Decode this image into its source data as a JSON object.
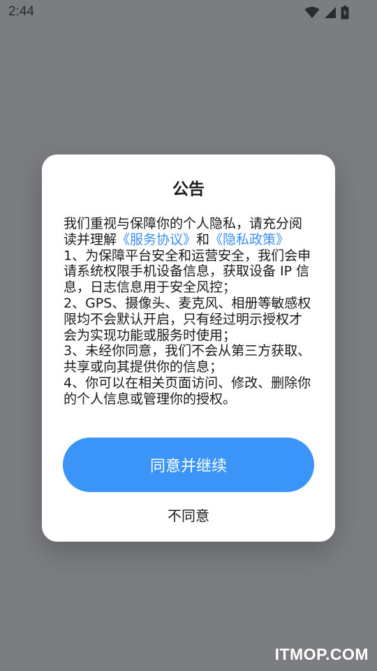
{
  "status_bar": {
    "time": "2:44",
    "icons": [
      "wifi-icon",
      "signal-icon",
      "battery-icon"
    ]
  },
  "dialog": {
    "title": "公告",
    "intro_prefix": "我们重视与保障你的个人隐私，请充分阅读并理解",
    "service_link": "《服务协议》",
    "intro_and": "和",
    "privacy_link": "《隐私政策》",
    "items": [
      "1、为保障平台安全和运营安全，我们会申请系统权限手机设备信息，获取设备 IP 信息，日志信息用于安全风控；",
      "2、GPS、摄像头、麦克风、相册等敏感权限均不会默认开启，只有经过明示授权才会为实现功能或服务时使用；",
      "3、未经你同意，我们不会从第三方获取、共享或向其提供你的信息；",
      "4、你可以在相关页面访问、修改、删除你的个人信息或管理你的授权。"
    ],
    "agree_label": "同意并继续",
    "disagree_label": "不同意"
  },
  "watermark": "ITMOP.COM",
  "colors": {
    "overlay": "#7b7d80",
    "accent": "#3b94f7",
    "link": "#3a8ff0"
  }
}
